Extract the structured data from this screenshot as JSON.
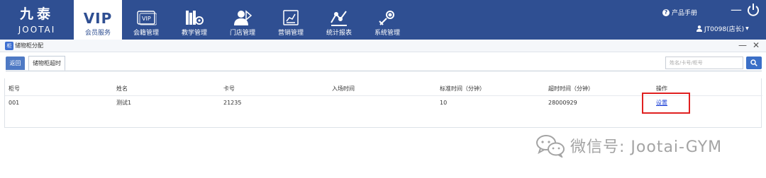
{
  "brand": {
    "name_cn": "九泰",
    "name_en": "JOOTAI"
  },
  "nav": {
    "vip_text": "VIP",
    "items": [
      {
        "label": "会员服务"
      },
      {
        "label": "会籍管理"
      },
      {
        "label": "教学管理"
      },
      {
        "label": "门店管理"
      },
      {
        "label": "营销管理"
      },
      {
        "label": "统计报表"
      },
      {
        "label": "系统管理"
      }
    ],
    "icons": [
      "vip-text",
      "vip-card-icon",
      "books-gear-icon",
      "person-store-icon",
      "chart-board-icon",
      "line-chart-icon",
      "wrench-gear-icon"
    ]
  },
  "header": {
    "manual": "产品手册",
    "minimize": "—",
    "user": "JT0098(店长)"
  },
  "window": {
    "title": "储物柜分配",
    "minimize": "—",
    "close": "✕"
  },
  "tabs": {
    "back": "返回",
    "current": "储物柜超时"
  },
  "search": {
    "placeholder": "姓名/卡号/柜号"
  },
  "table": {
    "headers": [
      "柜号",
      "姓名",
      "卡号",
      "入场时间",
      "标准时间（分钟）",
      "超时时间（分钟）",
      "操作"
    ],
    "rows": [
      {
        "locker": "001",
        "name": "测试1",
        "card": "21235",
        "entry_time": "",
        "standard_time": "10",
        "overtime": "28000929",
        "action": "设置"
      }
    ]
  },
  "watermark": "微信号: Jootai-GYM",
  "colors": {
    "topbar": "#2f4f92",
    "accent": "#3b6fc7",
    "link": "#1a3fd6",
    "highlight": "#e02020"
  }
}
